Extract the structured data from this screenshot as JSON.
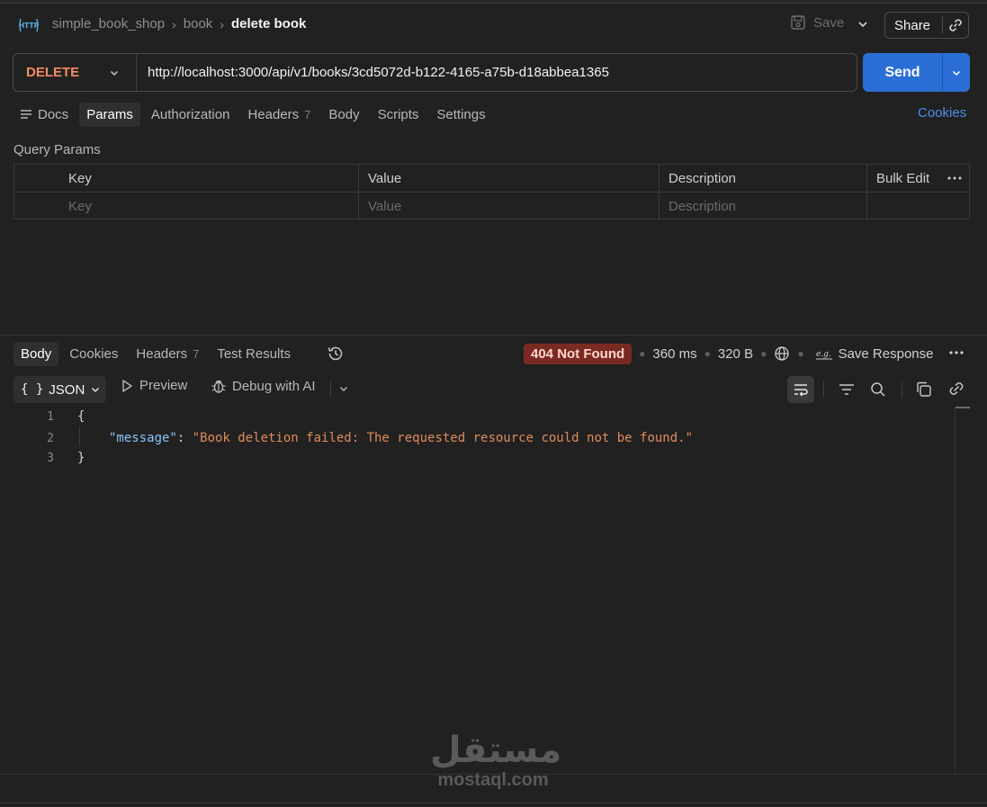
{
  "breadcrumb": {
    "collection": "simple_book_shop",
    "folder": "book",
    "request": "delete book"
  },
  "header": {
    "save_label": "Save",
    "share_label": "Share"
  },
  "request": {
    "method": "DELETE",
    "url": "http://localhost:3000/api/v1/books/3cd5072d-b122-4165-a75b-d18abbea1365",
    "send_label": "Send"
  },
  "request_tabs": {
    "docs": "Docs",
    "params": "Params",
    "authorization": "Authorization",
    "headers": "Headers",
    "headers_count": "7",
    "body": "Body",
    "scripts": "Scripts",
    "settings": "Settings",
    "cookies": "Cookies"
  },
  "query_params": {
    "title": "Query Params",
    "columns": {
      "key": "Key",
      "value": "Value",
      "description": "Description",
      "bulk_edit": "Bulk Edit"
    },
    "placeholders": {
      "key": "Key",
      "value": "Value",
      "description": "Description"
    }
  },
  "response_tabs": {
    "body": "Body",
    "cookies": "Cookies",
    "headers": "Headers",
    "headers_count": "7",
    "test_results": "Test Results"
  },
  "response_meta": {
    "status": "404 Not Found",
    "time": "360 ms",
    "size": "320 B",
    "save_response": "Save Response",
    "status_color": "#7a2a22"
  },
  "response_toolbar": {
    "format": "JSON",
    "preview": "Preview",
    "debug": "Debug with AI"
  },
  "response_body": {
    "line_numbers": [
      "1",
      "2",
      "3"
    ],
    "open_brace": "{",
    "key": "\"message\"",
    "colon": ": ",
    "value": "\"Book deletion failed: The requested resource could not be found.\"",
    "close_brace": "}"
  },
  "watermark": {
    "arabic": "مستقل",
    "latin": "mostaql.com"
  },
  "colors": {
    "accent": "#2b6fd6",
    "method": "#f28b63",
    "link": "#4a8ff0"
  }
}
